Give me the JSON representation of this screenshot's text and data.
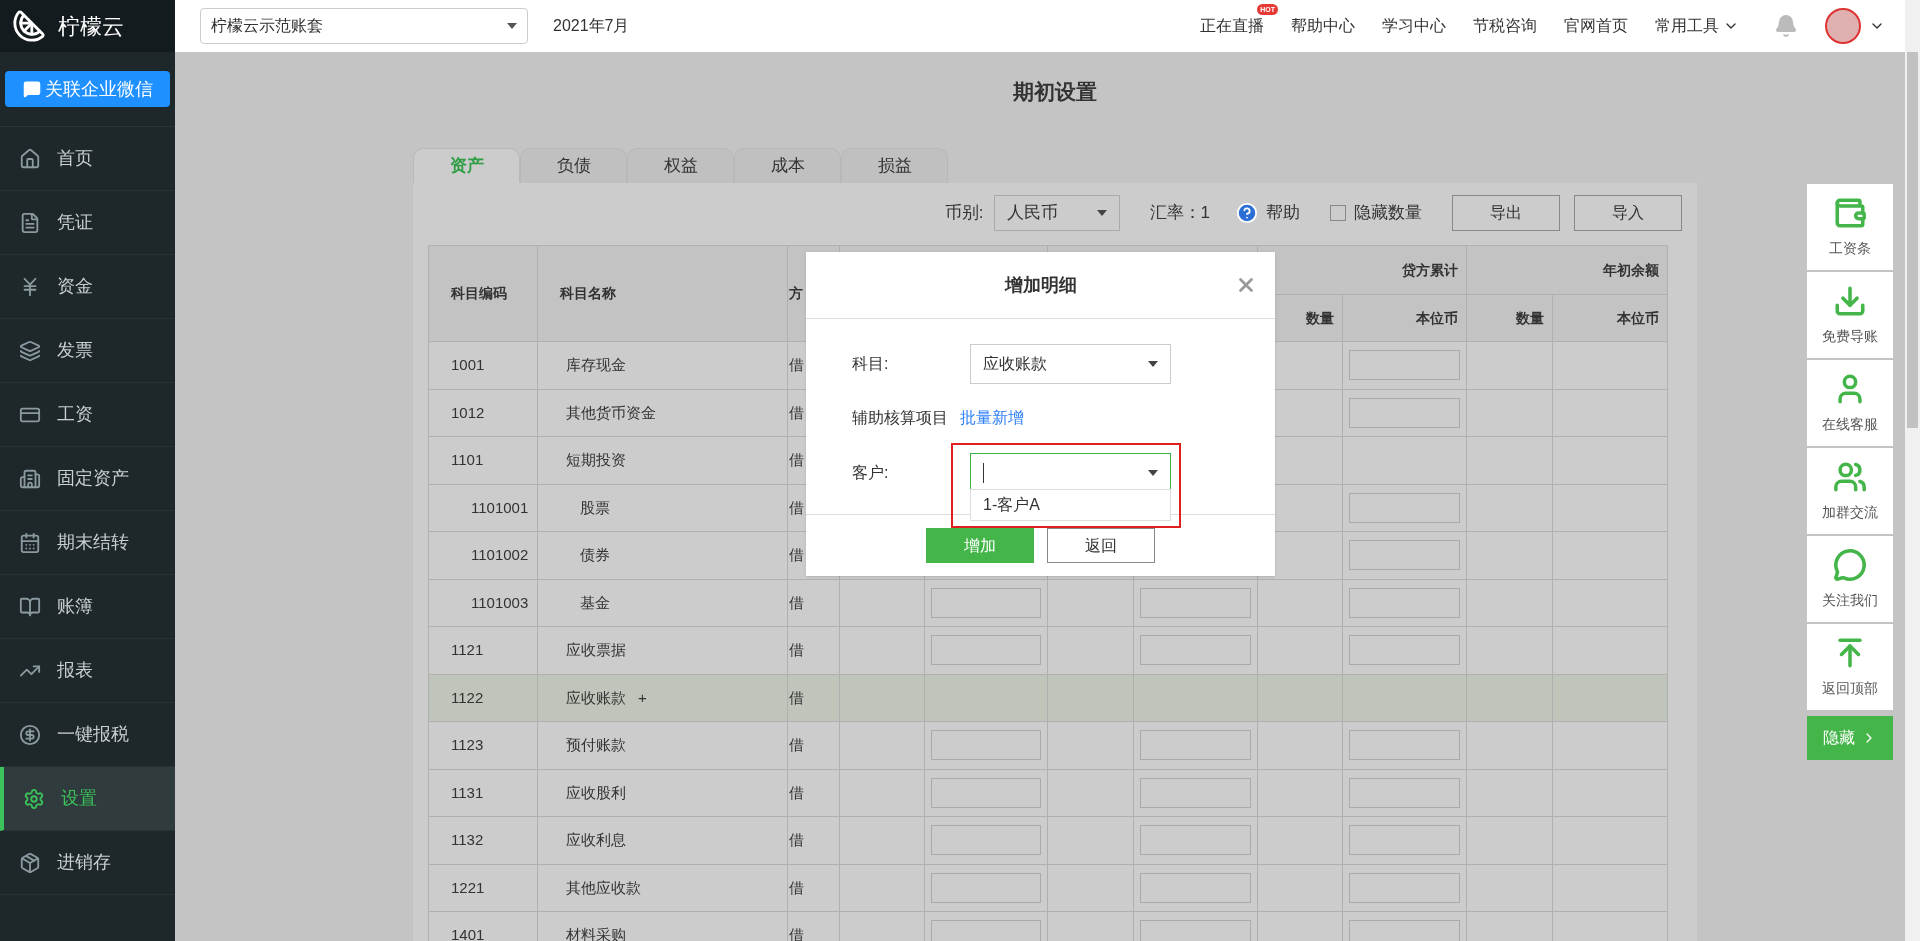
{
  "sidebar": {
    "logo": "柠檬云",
    "wechat_button": "关联企业微信",
    "items": [
      {
        "label": "首页",
        "selected": false
      },
      {
        "label": "凭证",
        "selected": false
      },
      {
        "label": "资金",
        "selected": false
      },
      {
        "label": "发票",
        "selected": false
      },
      {
        "label": "工资",
        "selected": false
      },
      {
        "label": "固定资产",
        "selected": false
      },
      {
        "label": "期末结转",
        "selected": false
      },
      {
        "label": "账簿",
        "selected": false
      },
      {
        "label": "报表",
        "selected": false
      },
      {
        "label": "一键报税",
        "selected": false
      },
      {
        "label": "设置",
        "selected": true
      },
      {
        "label": "进销存",
        "selected": false
      }
    ]
  },
  "topbar": {
    "account": "柠檬云示范账套",
    "period": "2021年7月",
    "links": [
      {
        "label": "正在直播",
        "badge": "HOT"
      },
      {
        "label": "帮助中心"
      },
      {
        "label": "学习中心"
      },
      {
        "label": "节税咨询"
      },
      {
        "label": "官网首页"
      }
    ],
    "tools_menu": "常用工具"
  },
  "page": {
    "title": "期初设置",
    "tabs": [
      {
        "label": "资产",
        "selected": true
      },
      {
        "label": "负债",
        "selected": false
      },
      {
        "label": "权益",
        "selected": false
      },
      {
        "label": "成本",
        "selected": false
      },
      {
        "label": "损益",
        "selected": false
      }
    ],
    "toolbar": {
      "currency_label": "币别:",
      "currency": "人民币",
      "rate": "汇率：1",
      "help": "帮助",
      "hide_quantity": {
        "label": "隐藏数量",
        "checked": false
      },
      "buttons": [
        "导出",
        "导入"
      ]
    }
  },
  "table": {
    "columns": [
      "科目编码",
      "科目名称",
      "方"
    ],
    "header_groups": [
      {
        "label": "贷方累计"
      },
      {
        "label": "年初余额"
      }
    ],
    "subheaders": [
      "数量",
      "本位币",
      "数量",
      "本位币"
    ],
    "rows": [
      {
        "code": "1001",
        "name": "库存现金",
        "direction": "借",
        "kind": "leaf",
        "highlighted": false
      },
      {
        "code": "1012",
        "name": "其他货币资金",
        "direction": "借",
        "kind": "leaf",
        "highlighted": false
      },
      {
        "code": "1101",
        "name": "短期投资",
        "direction": "借",
        "kind": "parent",
        "highlighted": false,
        "children": [
          {
            "code": "1101001",
            "name": "股票",
            "direction": "借",
            "kind": "leaf",
            "highlighted": false
          },
          {
            "code": "1101002",
            "name": "债券",
            "direction": "借",
            "kind": "leaf",
            "highlighted": false
          },
          {
            "code": "1101003",
            "name": "基金",
            "direction": "借",
            "kind": "leaf",
            "highlighted": false
          }
        ]
      },
      {
        "code": "1121",
        "name": "应收票据",
        "direction": "借",
        "kind": "leaf",
        "highlighted": false
      },
      {
        "code": "1122",
        "name": "应收账款",
        "direction": "借",
        "kind": "parent",
        "highlighted": true,
        "add": "+"
      },
      {
        "code": "1123",
        "name": "预付账款",
        "direction": "借",
        "kind": "leaf",
        "highlighted": false
      },
      {
        "code": "1131",
        "name": "应收股利",
        "direction": "借",
        "kind": "leaf",
        "highlighted": false
      },
      {
        "code": "1132",
        "name": "应收利息",
        "direction": "借",
        "kind": "leaf",
        "highlighted": false
      },
      {
        "code": "1221",
        "name": "其他应收款",
        "direction": "借",
        "kind": "leaf",
        "highlighted": false
      },
      {
        "code": "1401",
        "name": "材料采购",
        "direction": "借",
        "kind": "leaf",
        "highlighted": false
      }
    ]
  },
  "dialog": {
    "title": "增加明细",
    "subject_label": "科目:",
    "subject": "应收账款",
    "aux_label": "辅助核算项目",
    "aux_link": "批量新增",
    "customer_label": "客户:",
    "customer_options": [
      "1-客户A"
    ],
    "buttons": [
      {
        "label": "增加",
        "kind": "primary"
      },
      {
        "label": "返回",
        "kind": "secondary"
      }
    ]
  },
  "float_panel": {
    "items": [
      {
        "label": "工资条"
      },
      {
        "label": "免费导账"
      },
      {
        "label": "在线客服"
      },
      {
        "label": "加群交流"
      },
      {
        "label": "关注我们"
      },
      {
        "label": "返回顶部"
      }
    ],
    "hide_button": "隐藏"
  }
}
